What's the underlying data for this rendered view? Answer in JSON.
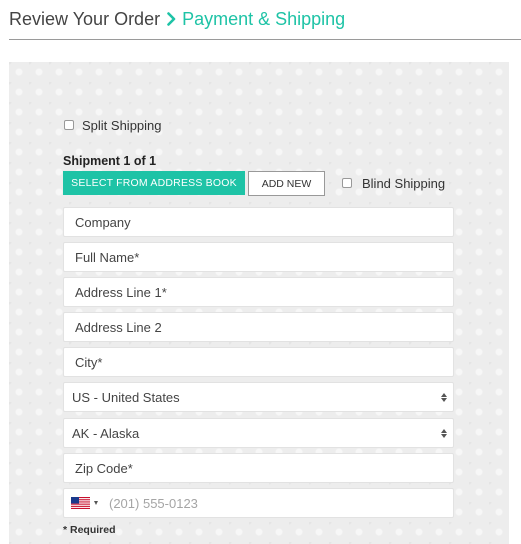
{
  "breadcrumb": {
    "step1": "Review Your Order",
    "separator_icon": "chevron-right-icon",
    "step2": "Payment & Shipping"
  },
  "colors": {
    "accent": "#1ec3a6",
    "panel_bg": "#ededed"
  },
  "form": {
    "split_shipping_label": "Split Shipping",
    "shipment_title": "Shipment 1 of 1",
    "select_address_button": "SELECT FROM ADDRESS BOOK",
    "add_new_button": "ADD NEW",
    "blind_shipping_label": "Blind Shipping",
    "company": "Company",
    "full_name": "Full Name*",
    "address1": "Address Line 1*",
    "address2": "Address Line 2",
    "city": "City*",
    "country": "US - United States",
    "state": "AK - Alaska",
    "zip": "Zip Code*",
    "phone_flag": "us-flag-icon",
    "phone_placeholder": "(201) 555-0123",
    "required_note": "* Required"
  }
}
